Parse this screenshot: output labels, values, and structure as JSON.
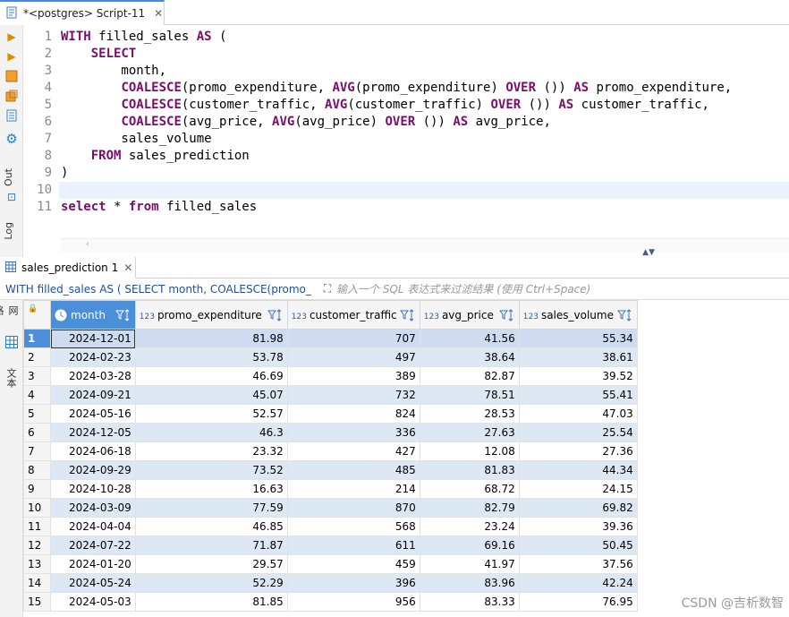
{
  "editor_tab": {
    "title": "*<postgres> Script-11",
    "close": "✕"
  },
  "left_toolbar": {
    "out_label": "Out",
    "log_label": "Log"
  },
  "sql_lines": [
    {
      "n": "1",
      "segs": [
        [
          "kw",
          "WITH"
        ],
        [
          "t",
          " filled_sales "
        ],
        [
          "kw",
          "AS"
        ],
        [
          "t",
          " ("
        ]
      ]
    },
    {
      "n": "2",
      "segs": [
        [
          "t",
          "    "
        ],
        [
          "kw",
          "SELECT"
        ]
      ]
    },
    {
      "n": "3",
      "segs": [
        [
          "t",
          "        month,"
        ]
      ]
    },
    {
      "n": "4",
      "segs": [
        [
          "t",
          "        "
        ],
        [
          "kw",
          "COALESCE"
        ],
        [
          "t",
          "(promo_expenditure, "
        ],
        [
          "kw",
          "AVG"
        ],
        [
          "t",
          "(promo_expenditure) "
        ],
        [
          "kw",
          "OVER"
        ],
        [
          "t",
          " ()) "
        ],
        [
          "kw",
          "AS"
        ],
        [
          "t",
          " promo_expenditure,"
        ]
      ]
    },
    {
      "n": "5",
      "segs": [
        [
          "t",
          "        "
        ],
        [
          "kw",
          "COALESCE"
        ],
        [
          "t",
          "(customer_traffic, "
        ],
        [
          "kw",
          "AVG"
        ],
        [
          "t",
          "(customer_traffic) "
        ],
        [
          "kw",
          "OVER"
        ],
        [
          "t",
          " ()) "
        ],
        [
          "kw",
          "AS"
        ],
        [
          "t",
          " customer_traffic,"
        ]
      ]
    },
    {
      "n": "6",
      "segs": [
        [
          "t",
          "        "
        ],
        [
          "kw",
          "COALESCE"
        ],
        [
          "t",
          "(avg_price, "
        ],
        [
          "kw",
          "AVG"
        ],
        [
          "t",
          "(avg_price) "
        ],
        [
          "kw",
          "OVER"
        ],
        [
          "t",
          " ()) "
        ],
        [
          "kw",
          "AS"
        ],
        [
          "t",
          " avg_price,"
        ]
      ]
    },
    {
      "n": "7",
      "segs": [
        [
          "t",
          "        sales_volume"
        ]
      ]
    },
    {
      "n": "8",
      "segs": [
        [
          "t",
          "    "
        ],
        [
          "kw",
          "FROM"
        ],
        [
          "t",
          " sales_prediction"
        ]
      ]
    },
    {
      "n": "9",
      "segs": [
        [
          "t",
          ")"
        ]
      ]
    },
    {
      "n": "10",
      "segs": [
        [
          "t",
          ""
        ]
      ]
    },
    {
      "n": "11",
      "segs": [
        [
          "kw",
          "select"
        ],
        [
          "t",
          " * "
        ],
        [
          "kw",
          "from"
        ],
        [
          "t",
          " filled_sales"
        ]
      ]
    }
  ],
  "results_tab": {
    "title": "sales_prediction 1",
    "close": "✕"
  },
  "filter": {
    "query": "WITH filled_sales AS ( SELECT month, COALESCE(promo_",
    "placeholder": "输入一个 SQL 表达式来过滤结果 (使用 Ctrl+Space)"
  },
  "result_side": {
    "grid_label": "网格",
    "text_label": "文本"
  },
  "grid": {
    "columns": [
      {
        "type": "",
        "name": "month"
      },
      {
        "type": "123",
        "name": "promo_expenditure"
      },
      {
        "type": "123",
        "name": "customer_traffic"
      },
      {
        "type": "123",
        "name": "avg_price"
      },
      {
        "type": "123",
        "name": "sales_volume"
      }
    ],
    "rows": [
      [
        "1",
        "2024-12-01",
        "81.98",
        "707",
        "41.56",
        "55.34"
      ],
      [
        "2",
        "2024-02-23",
        "53.78",
        "497",
        "38.64",
        "38.61"
      ],
      [
        "3",
        "2024-03-28",
        "46.69",
        "389",
        "82.87",
        "39.52"
      ],
      [
        "4",
        "2024-09-21",
        "45.07",
        "732",
        "78.51",
        "55.41"
      ],
      [
        "5",
        "2024-05-16",
        "52.57",
        "824",
        "28.53",
        "47.03"
      ],
      [
        "6",
        "2024-12-05",
        "46.3",
        "336",
        "27.63",
        "25.54"
      ],
      [
        "7",
        "2024-06-18",
        "23.32",
        "427",
        "12.08",
        "27.36"
      ],
      [
        "8",
        "2024-09-29",
        "73.52",
        "485",
        "81.83",
        "44.34"
      ],
      [
        "9",
        "2024-10-28",
        "16.63",
        "214",
        "68.72",
        "24.15"
      ],
      [
        "10",
        "2024-03-09",
        "77.59",
        "870",
        "82.79",
        "69.82"
      ],
      [
        "11",
        "2024-04-04",
        "46.85",
        "568",
        "23.24",
        "39.36"
      ],
      [
        "12",
        "2024-07-22",
        "71.87",
        "611",
        "69.16",
        "50.45"
      ],
      [
        "13",
        "2024-01-20",
        "29.57",
        "459",
        "41.97",
        "37.56"
      ],
      [
        "14",
        "2024-05-24",
        "52.29",
        "396",
        "83.96",
        "42.24"
      ],
      [
        "15",
        "2024-05-03",
        "81.85",
        "956",
        "83.33",
        "76.95"
      ]
    ]
  },
  "watermark": "CSDN @吉析数智"
}
